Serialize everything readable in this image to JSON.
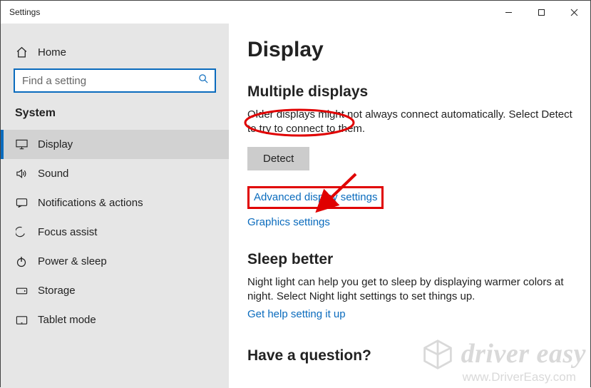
{
  "window": {
    "title": "Settings"
  },
  "sidebar": {
    "home": "Home",
    "search_placeholder": "Find a setting",
    "category": "System",
    "items": [
      {
        "label": "Display",
        "icon": "display"
      },
      {
        "label": "Sound",
        "icon": "sound"
      },
      {
        "label": "Notifications & actions",
        "icon": "notifications"
      },
      {
        "label": "Focus assist",
        "icon": "focus"
      },
      {
        "label": "Power & sleep",
        "icon": "power"
      },
      {
        "label": "Storage",
        "icon": "storage"
      },
      {
        "label": "Tablet mode",
        "icon": "tablet"
      }
    ]
  },
  "main": {
    "page_title": "Display",
    "multiple_displays": {
      "heading": "Multiple displays",
      "body": "Older displays might not always connect automatically. Select Detect to try to connect to them.",
      "detect_button": "Detect",
      "advanced_link": "Advanced display settings",
      "graphics_link": "Graphics settings"
    },
    "sleep_better": {
      "heading": "Sleep better",
      "body": "Night light can help you get to sleep by displaying warmer colors at night. Select Night light settings to set things up.",
      "help_link": "Get help setting it up"
    },
    "question_heading": "Have a question?"
  },
  "watermark": {
    "line1": "driver easy",
    "line2": "www.DriverEasy.com"
  },
  "annotations": {
    "ellipse_around": "Multiple displays",
    "red_box_around": "Advanced display settings",
    "arrow_points_to": "Advanced display settings"
  },
  "colors": {
    "accent": "#0a6bbd",
    "annotation": "#e00000",
    "sidebar_bg": "#e6e6e6"
  }
}
